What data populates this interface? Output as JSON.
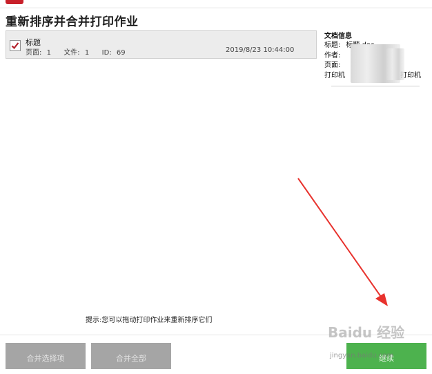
{
  "window": {
    "title": "重新排序并合并打印作业"
  },
  "jobs": [
    {
      "name": "标题",
      "pages_label": "页面:",
      "pages": "1",
      "files_label": "文件:",
      "files": "1",
      "id_label": "ID:",
      "id": "69",
      "date": "2019/8/23 10:44:00",
      "checked": true
    }
  ],
  "doc_info": {
    "heading": "文档信息",
    "title_label": "标题:",
    "title_value": "标题.doc",
    "author_label": "作者:",
    "pages_label": "页面:",
    "printer_label": "打印机",
    "printer_value": "打印机"
  },
  "hint": "提示:您可以拖动打印作业来重新排序它们",
  "buttons": {
    "merge_selected": "合并选择项",
    "merge_all": "合并全部",
    "continue": "继续"
  },
  "watermark": {
    "brand": "Baidu 经验",
    "url": "jingyan.baidu.com"
  },
  "colors": {
    "accent_green": "#4db24e",
    "disabled_gray": "#a5a5a5",
    "arrow_red": "#e8322d"
  }
}
